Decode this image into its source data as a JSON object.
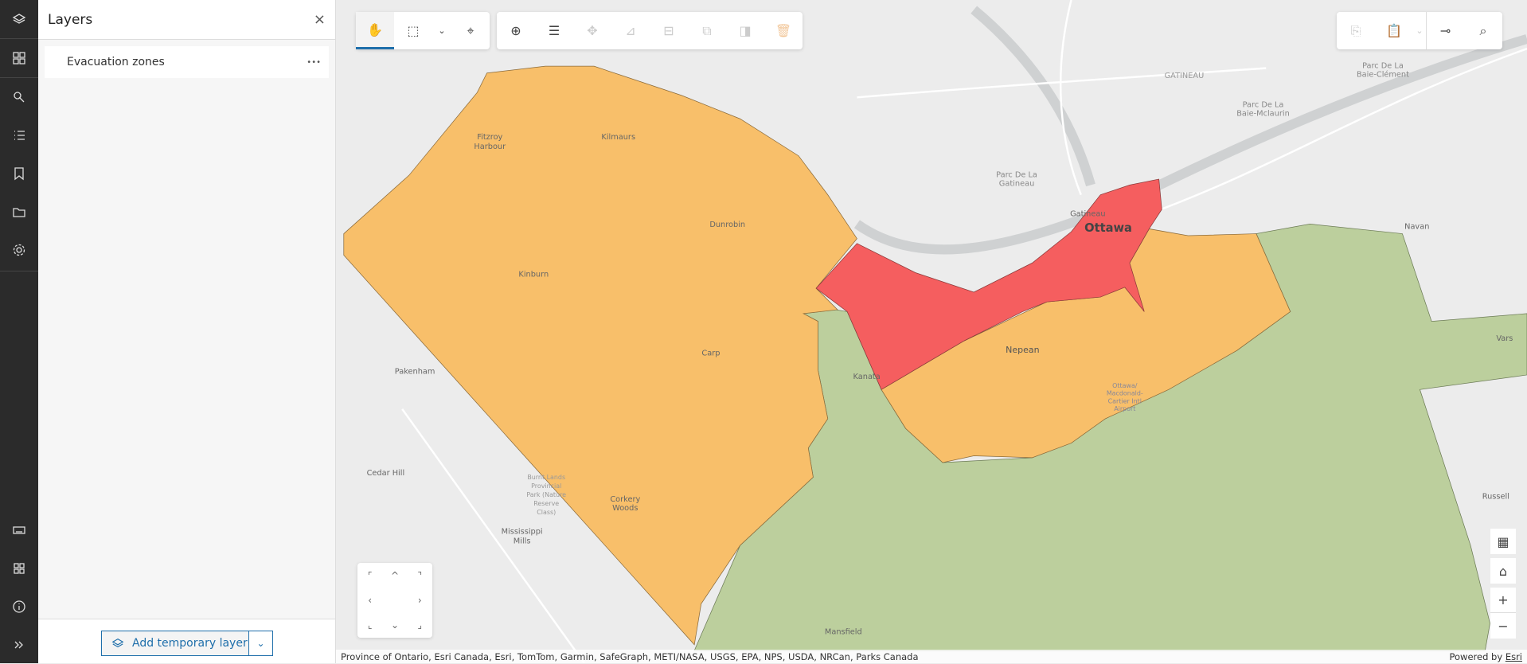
{
  "rail": {
    "top_icons": [
      "layers-icon",
      "basemap-gallery-icon",
      "select-icon",
      "legend-icon",
      "bookmark-icon",
      "folder-icon",
      "settings-icon"
    ],
    "bottom_icons": [
      "keyboard-icon",
      "apps-grid-icon",
      "info-icon",
      "expand-icon"
    ]
  },
  "panel": {
    "title": "Layers",
    "close": "×",
    "layers": [
      {
        "name": "Evacuation zones",
        "menu": "•••"
      }
    ],
    "add_button": "Add temporary layer",
    "dropdown": "⌄"
  },
  "toolbar": {
    "pan": "pan-icon",
    "selection": [
      "rectangle-select-icon",
      "chevron-down-icon",
      "lasso-select-icon"
    ],
    "edit": [
      "add-feature-icon",
      "attribute-list-icon",
      "move-icon",
      "reshape-icon",
      "split-icon",
      "merge-icon",
      "replace-geometry-icon",
      "delete-icon"
    ],
    "right": [
      "copy-icon",
      "paste-icon",
      "chevron-down-icon",
      "snapping-icon",
      "search-icon"
    ]
  },
  "map": {
    "colors": {
      "high": "#f55e5f",
      "medium": "#f8bf6a",
      "low": "#bccf9d",
      "basemap": "#ececec"
    },
    "labels": {
      "fitzroy": "Fitzroy",
      "harbour": "Harbour",
      "kilmaurs": "Kilmaurs",
      "dunrobin": "Dunrobin",
      "kinburn": "Kinburn",
      "carp": "Carp",
      "kanata": "Kanata",
      "nepean": "Nepean",
      "ottawa": "Ottawa",
      "gatineau_city": "Gatineau",
      "gatineau": "GATINEAU",
      "parc_gat1": "Parc De La",
      "parc_gat2": "Gatineau",
      "parc_mc1": "Parc De La",
      "parc_mc2": "Baie-Mclaurin",
      "parc_cl1": "Parc De La",
      "parc_cl2": "Baie-Clément",
      "navan": "Navan",
      "vars": "Vars",
      "russell": "Russell",
      "pakenham": "Pakenham",
      "cedar_hill": "Cedar Hill",
      "burnt1": "Burnt Lands",
      "burnt2": "Provincial",
      "burnt3": "Park (Nature",
      "burnt4": "Reserve",
      "burnt5": "Class)",
      "corkery1": "Corkery",
      "corkery2": "Woods",
      "miss1": "Mississippi",
      "miss2": "Mills",
      "mansfield": "Mansfield",
      "airport1": "Ottawa/",
      "airport2": "Macdonald-",
      "airport3": "Cartier Intl",
      "airport4": "Airport"
    }
  },
  "controls": {
    "table": "table-settings-icon",
    "home": "home-icon",
    "zoom_in": "+",
    "zoom_out": "−"
  },
  "nav": {
    "up": "^",
    "down": "⌄",
    "left": "‹",
    "right": "›"
  },
  "attribution": {
    "text": "Province of Ontario, Esri Canada, Esri, TomTom, Garmin, SafeGraph, METI/NASA, USGS, EPA, NPS, USDA, NRCan, Parks Canada",
    "powered": "Powered by ",
    "esri": "Esri"
  }
}
